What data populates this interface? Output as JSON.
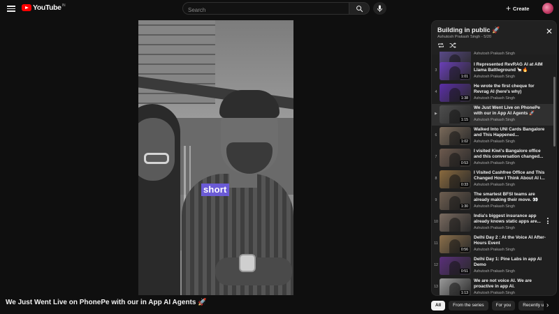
{
  "header": {
    "logo_text": "YouTube",
    "logo_country": "IN",
    "search_placeholder": "Search",
    "create_label": "Create",
    "icons": [
      "menu-icon",
      "search-icon",
      "mic-icon",
      "plus-icon",
      "avatar"
    ]
  },
  "video": {
    "overlay_text": "short",
    "title": "We Just Went Live on PhonePe with our in App AI Agents 🚀"
  },
  "playlist": {
    "title": "Building in public 🚀",
    "owner": "Ashutosh Prakash Singh",
    "position": "5/20",
    "owner_position": "Ashutosh Prakash Singh - 5/20",
    "items": [
      {
        "index": "",
        "title": "",
        "channel": "Ashutosh Prakash Singh",
        "duration": "",
        "thumb": "#5a4a8a"
      },
      {
        "index": "3",
        "title": "I Represented RevRAG AI at AIM Llama Battleground 🦙🔥",
        "channel": "Ashutosh Prakash Singh",
        "duration": "1:01",
        "thumb": "#6a3fb8"
      },
      {
        "index": "4",
        "title": "He wrote the first cheque for Revrag AI (here's why)",
        "channel": "Ashutosh Prakash Singh",
        "duration": "1:38",
        "thumb": "#5b2ea8"
      },
      {
        "index": "▶",
        "title": "We Just Went Live on PhonePe with our in App AI Agents 🚀",
        "channel": "Ashutosh Prakash Singh",
        "duration": "1:15",
        "thumb": "#4e4e4e",
        "active": true
      },
      {
        "index": "6",
        "title": "Walked Into UNI Cards Bangalore and This Happened...",
        "channel": "Ashutosh Prakash Singh",
        "duration": "1:02",
        "thumb": "#7a6a5a"
      },
      {
        "index": "7",
        "title": "I visited Kiwi's Bangalore office and this conversation changed...",
        "channel": "Ashutosh Prakash Singh",
        "duration": "0:53",
        "thumb": "#6d5a4e"
      },
      {
        "index": "8",
        "title": "I Visited Cashfree Office and This Changed How I Think About AI i...",
        "channel": "Ashutosh Prakash Singh",
        "duration": "0:33",
        "thumb": "#8a6a3e"
      },
      {
        "index": "9",
        "title": "The smartest BFSI teams are already making their move. 👀",
        "channel": "Ashutosh Prakash Singh",
        "duration": "1:30",
        "thumb": "#6e5e50"
      },
      {
        "index": "10",
        "title": "India's biggest insurance app already knows static apps are...",
        "channel": "Ashutosh Prakash Singh",
        "duration": "",
        "thumb": "#7a6b60",
        "hover": true
      },
      {
        "index": "11",
        "title": "Delhi Day 2 : At the Voice AI After-Hours Event",
        "channel": "Ashutosh Prakash Singh",
        "duration": "0:56",
        "thumb": "#8b6f4a"
      },
      {
        "index": "12",
        "title": "Delhi Day 1: Pine Labs in app AI Demo",
        "channel": "Ashutosh Prakash Singh",
        "duration": "0:51",
        "thumb": "#5a2f7a"
      },
      {
        "index": "13",
        "title": "We are not voice AI. We are proactive in app AI.",
        "channel": "Ashutosh Prakash Singh",
        "duration": "1:13",
        "thumb": "#9a9a9a"
      }
    ]
  },
  "chips": [
    {
      "label": "All",
      "active": true
    },
    {
      "label": "From the series",
      "active": false
    },
    {
      "label": "For you",
      "active": false
    },
    {
      "label": "Recently uploaded",
      "active": false
    }
  ]
}
